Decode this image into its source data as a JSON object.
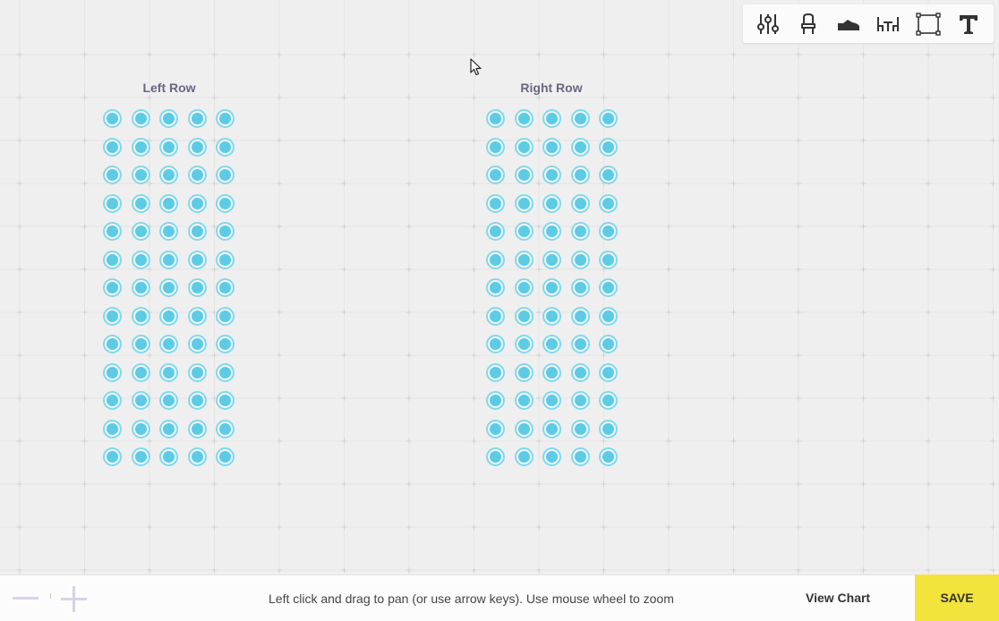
{
  "canvas": {
    "rows": [
      {
        "label": "Left Row",
        "seat_rows": 13,
        "seat_cols": 5
      },
      {
        "label": "Right Row",
        "seat_rows": 13,
        "seat_cols": 5
      }
    ]
  },
  "toolbar": {
    "tools": [
      {
        "icon": "sliders-icon"
      },
      {
        "icon": "chair-icon"
      },
      {
        "icon": "shoe-icon"
      },
      {
        "icon": "table-chairs-icon"
      },
      {
        "icon": "select-area-icon"
      },
      {
        "icon": "text-icon"
      }
    ]
  },
  "footer": {
    "hint": "Left click and drag to pan (or use arrow keys). Use mouse wheel to zoom",
    "view_chart_label": "View Chart",
    "save_label": "SAVE"
  },
  "colors": {
    "seat_fill": "#5ccbe6",
    "seat_ring": "#7fd9ee",
    "save_bg": "#f2e33d",
    "row_label": "#6b6585"
  }
}
